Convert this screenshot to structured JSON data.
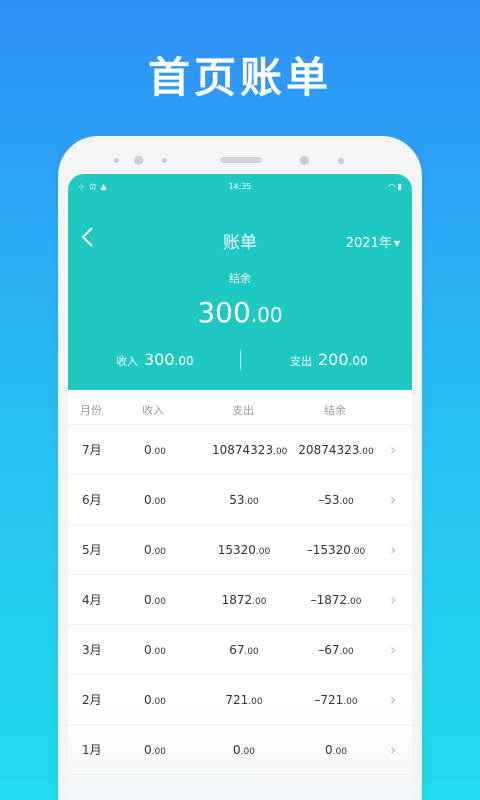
{
  "promo": {
    "title": "首页账单"
  },
  "status_bar": {
    "left": "⊹ ⊡ ▲",
    "time": "14:35",
    "right": "◠ ▮"
  },
  "nav": {
    "title": "账单",
    "year": "2021年"
  },
  "balance": {
    "label": "结余",
    "int": "300",
    "dec": ".00"
  },
  "summary": {
    "income_label": "收入",
    "income_int": "300",
    "income_dec": ".00",
    "expense_label": "支出",
    "expense_int": "200",
    "expense_dec": ".00"
  },
  "table": {
    "headers": [
      "月份",
      "收入",
      "支出",
      "结余"
    ],
    "rows": [
      {
        "month": "7月",
        "income_int": "0",
        "income_dec": ".00",
        "expense_int": "10874323",
        "expense_dec": ".00",
        "balance_int": "20874323",
        "balance_dec": ".00"
      },
      {
        "month": "6月",
        "income_int": "0",
        "income_dec": ".00",
        "expense_int": "53",
        "expense_dec": ".00",
        "balance_int": "–53",
        "balance_dec": ".00"
      },
      {
        "month": "5月",
        "income_int": "0",
        "income_dec": ".00",
        "expense_int": "15320",
        "expense_dec": ".00",
        "balance_int": "–15320",
        "balance_dec": ".00"
      },
      {
        "month": "4月",
        "income_int": "0",
        "income_dec": ".00",
        "expense_int": "1872",
        "expense_dec": ".00",
        "balance_int": "–1872",
        "balance_dec": ".00"
      },
      {
        "month": "3月",
        "income_int": "0",
        "income_dec": ".00",
        "expense_int": "67",
        "expense_dec": ".00",
        "balance_int": "–67",
        "balance_dec": ".00"
      },
      {
        "month": "2月",
        "income_int": "0",
        "income_dec": ".00",
        "expense_int": "721",
        "expense_dec": ".00",
        "balance_int": "–721",
        "balance_dec": ".00"
      },
      {
        "month": "1月",
        "income_int": "0",
        "income_dec": ".00",
        "expense_int": "0",
        "expense_dec": ".00",
        "balance_int": "0",
        "balance_dec": ".00"
      }
    ]
  },
  "icons": {
    "back": "back-arrow-icon",
    "caret": "caret-down-icon",
    "chevron": "chevron-right-icon"
  },
  "colors": {
    "header": "#1ec8c3",
    "background_top": "#2e8ff7",
    "background_bottom": "#22dcf0"
  }
}
